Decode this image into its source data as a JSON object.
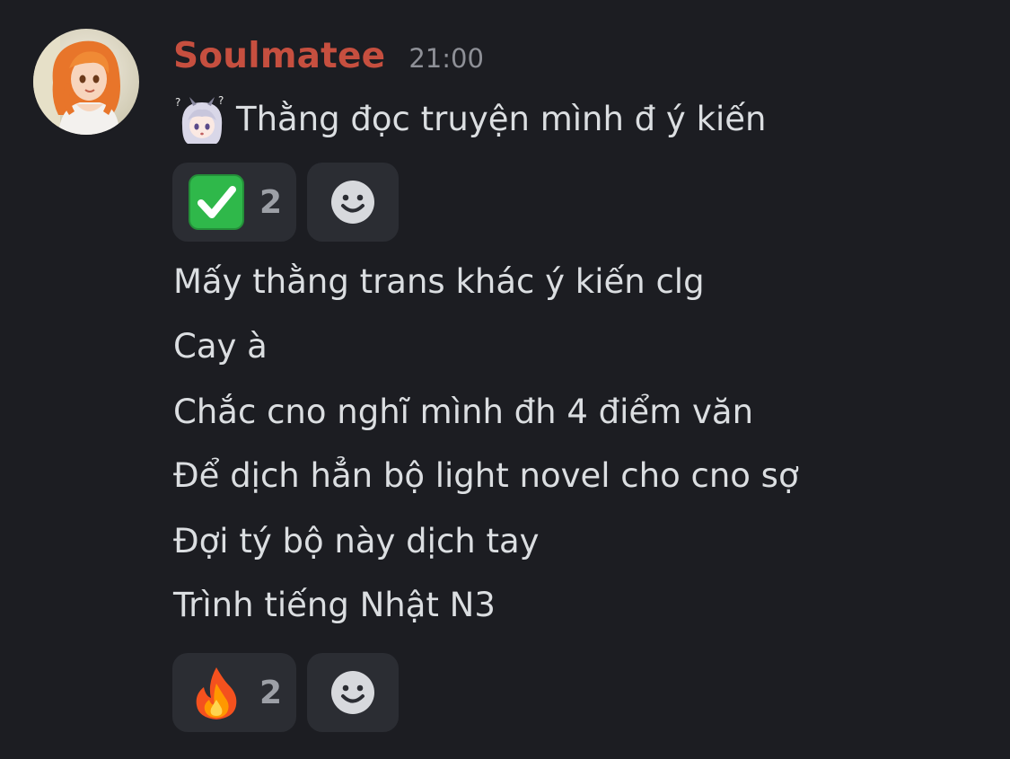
{
  "message": {
    "author": "Soulmatee",
    "timestamp": "21:00",
    "avatar_icon": "user-avatar-anime-icon",
    "first_line": "Thằng đọc truyện mình đ ý kiến",
    "first_line_emoji": "confused-anime-girl-emoji-icon",
    "lines": [
      "Mấy thằng trans khác ý kiến clg",
      "Cay à",
      "Chắc cno nghĩ mình đh 4 điểm văn",
      "Để dịch hẳn bộ light novel cho cno sợ",
      "Đợi tý bộ này dịch tay",
      "Trình tiếng Nhật N3"
    ]
  },
  "reactions_first": [
    {
      "emoji": "white-check-mark-icon",
      "count": "2"
    },
    {
      "emoji": "add-reaction-smiley-icon"
    }
  ],
  "reactions_second": [
    {
      "emoji": "fire-icon",
      "count": "2"
    },
    {
      "emoji": "add-reaction-smiley-icon"
    }
  ],
  "colors": {
    "background": "#1c1d22",
    "username": "#c64f3f",
    "text": "#dbdee1",
    "timestamp": "#8e9097",
    "reaction_bg": "#2b2d33",
    "check_green": "#2fb84a"
  }
}
